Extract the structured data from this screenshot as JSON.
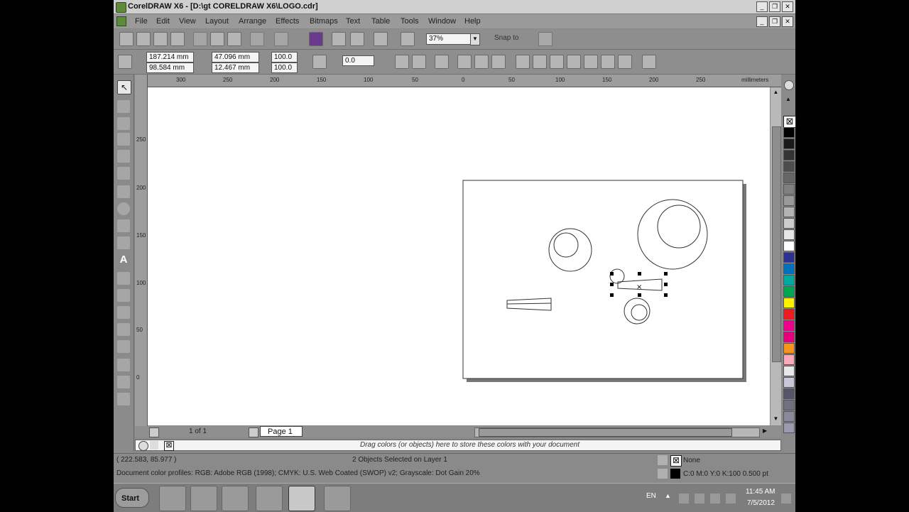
{
  "window": {
    "title": "CorelDRAW X6 - [D:\\gt CORELDRAW X6\\LOGO.cdr]",
    "controls": {
      "minimize": "_",
      "restore": "❐",
      "close": "✕"
    }
  },
  "menu": [
    "File",
    "Edit",
    "View",
    "Layout",
    "Arrange",
    "Effects",
    "Bitmaps",
    "Text",
    "Table",
    "Tools",
    "Window",
    "Help"
  ],
  "standard_toolbar": {
    "zoom_value": "37%",
    "snap_to_label": "Snap to"
  },
  "property_bar": {
    "x": "187.214 mm",
    "y": "98.584 mm",
    "width": "47.096 mm",
    "height": "12.467 mm",
    "scale_x": "100.0",
    "scale_y": "100.0",
    "rotation": "0.0"
  },
  "ruler": {
    "h_ticks": [
      "300",
      "250",
      "200",
      "150",
      "100",
      "50",
      "0",
      "50",
      "100",
      "150",
      "200",
      "250",
      "millimeters"
    ],
    "v_ticks": [
      "250",
      "200",
      "150",
      "100",
      "50",
      "0"
    ]
  },
  "page_nav": {
    "counter": "1 of 1",
    "page_tab": "Page 1"
  },
  "color_tray": {
    "hint": "Drag colors (or objects) here to store these colors with your document"
  },
  "status": {
    "coords": "( 222.583, 85.977 )",
    "selection": "2 Objects Selected on Layer 1",
    "profiles": "Document color profiles: RGB: Adobe RGB (1998); CMYK: U.S. Web Coated (SWOP) v2; Grayscale: Dot Gain 20%",
    "fill": "None",
    "outline": "C:0 M:0 Y:0 K:100  0.500 pt"
  },
  "taskbar": {
    "start": "Start",
    "lang": "EN",
    "time": "11:45 AM",
    "date": "7/5/2012"
  },
  "palette_colors": [
    "#ffffff",
    "#000000",
    "#1a1a1a",
    "#333333",
    "#4d4d4d",
    "#666666",
    "#808080",
    "#999999",
    "#b3b3b3",
    "#cccccc",
    "#e6e6e6",
    "#ffffff",
    "#2e3192",
    "#0072bc",
    "#00a99d",
    "#00a651",
    "#fff200",
    "#ed1c24",
    "#ec008c",
    "#e6007e",
    "#f7941d",
    "#f9a9b7",
    "#e8e8e8",
    "#c8c8d8",
    "#55556a",
    "#707080",
    "#8a8a9a",
    "#9b9bb0"
  ],
  "icons": {
    "app": "coreldraw-icon",
    "pick": "pick-tool-icon",
    "text": "text-tool-icon"
  }
}
